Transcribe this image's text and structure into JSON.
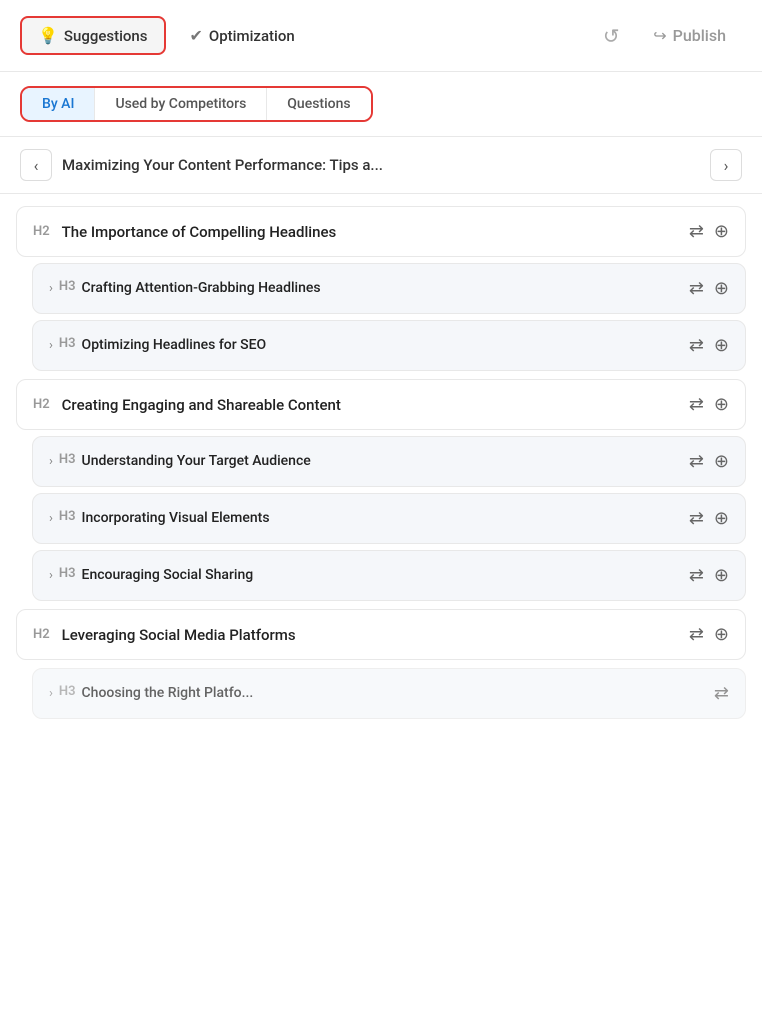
{
  "header": {
    "suggestions_label": "Suggestions",
    "optimization_label": "Optimization",
    "undo_icon": "↺",
    "publish_label": "Publish",
    "publish_icon": "↪"
  },
  "subtabs": [
    {
      "id": "by-ai",
      "label": "By AI",
      "active": true
    },
    {
      "id": "used-by-competitors",
      "label": "Used by Competitors",
      "active": false
    },
    {
      "id": "questions",
      "label": "Questions",
      "active": false
    }
  ],
  "content_nav": {
    "title": "Maximizing Your Content Performance: Tips a...",
    "prev_icon": "‹",
    "next_icon": "›"
  },
  "outline": [
    {
      "type": "h2",
      "label": "H2",
      "text": "The Importance of Compelling Headlines",
      "children": [
        {
          "type": "h3",
          "label": "H3",
          "text": "Crafting Attention-Grabbing Headlines"
        },
        {
          "type": "h3",
          "label": "H3",
          "text": "Optimizing Headlines for SEO"
        }
      ]
    },
    {
      "type": "h2",
      "label": "H2",
      "text": "Creating Engaging and Shareable Content",
      "children": [
        {
          "type": "h3",
          "label": "H3",
          "text": "Understanding Your Target Audience"
        },
        {
          "type": "h3",
          "label": "H3",
          "text": "Incorporating Visual Elements"
        },
        {
          "type": "h3",
          "label": "H3",
          "text": "Encouraging Social Sharing"
        }
      ]
    },
    {
      "type": "h2",
      "label": "H2",
      "text": "Leveraging Social Media Platforms",
      "children": []
    }
  ],
  "colors": {
    "accent_red": "#e53935",
    "active_blue": "#1976d2",
    "active_bg": "#e8f4ff",
    "item_bg": "#f5f7fa"
  }
}
